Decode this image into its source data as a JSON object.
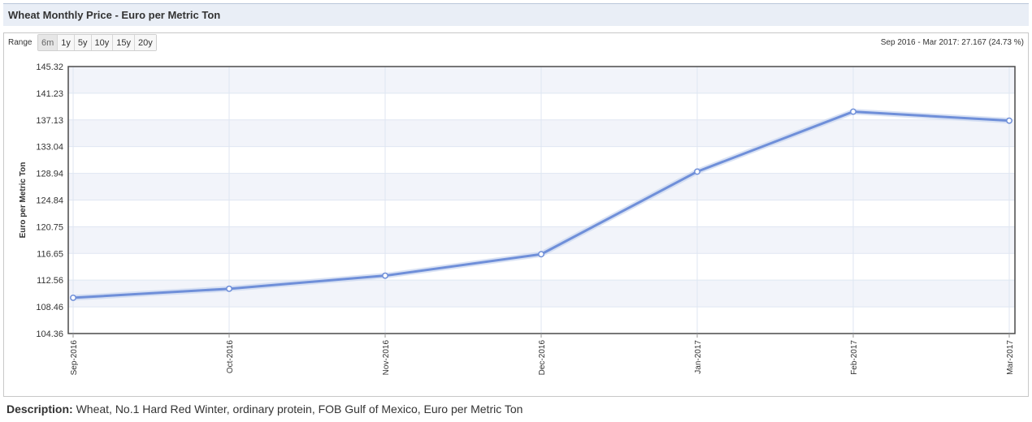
{
  "header": {
    "title": "Wheat Monthly Price - Euro per Metric Ton"
  },
  "range": {
    "label": "Range",
    "buttons": [
      "6m",
      "1y",
      "5y",
      "10y",
      "15y",
      "20y"
    ],
    "active": "6m",
    "summary": "Sep 2016 - Mar 2017: 27.167 (24.73 %)"
  },
  "colors": {
    "line": "#6f8fd9",
    "band": "#f2f4fa",
    "grid": "#dfe6f2",
    "frame": "#4a4a4a"
  },
  "chart_data": {
    "type": "line",
    "title": "",
    "xlabel": "",
    "ylabel": "Euro per Metric Ton",
    "x": [
      "Sep-2016",
      "Oct-2016",
      "Nov-2016",
      "Dec-2016",
      "Jan-2017",
      "Feb-2017",
      "Mar-2017"
    ],
    "series": [
      {
        "values": [
          109.85,
          111.23,
          113.24,
          116.53,
          129.2,
          138.4,
          137.02
        ]
      }
    ],
    "yticks": [
      "104.36",
      "108.46",
      "112.56",
      "116.65",
      "120.75",
      "124.84",
      "128.94",
      "133.04",
      "137.13",
      "141.23",
      "145.32"
    ],
    "ylim": [
      104.36,
      145.32
    ],
    "grid": true,
    "legend": "none"
  },
  "description": {
    "label": "Description:",
    "text": "Wheat, No.1 Hard Red Winter, ordinary protein, FOB Gulf of Mexico, Euro per Metric Ton"
  }
}
